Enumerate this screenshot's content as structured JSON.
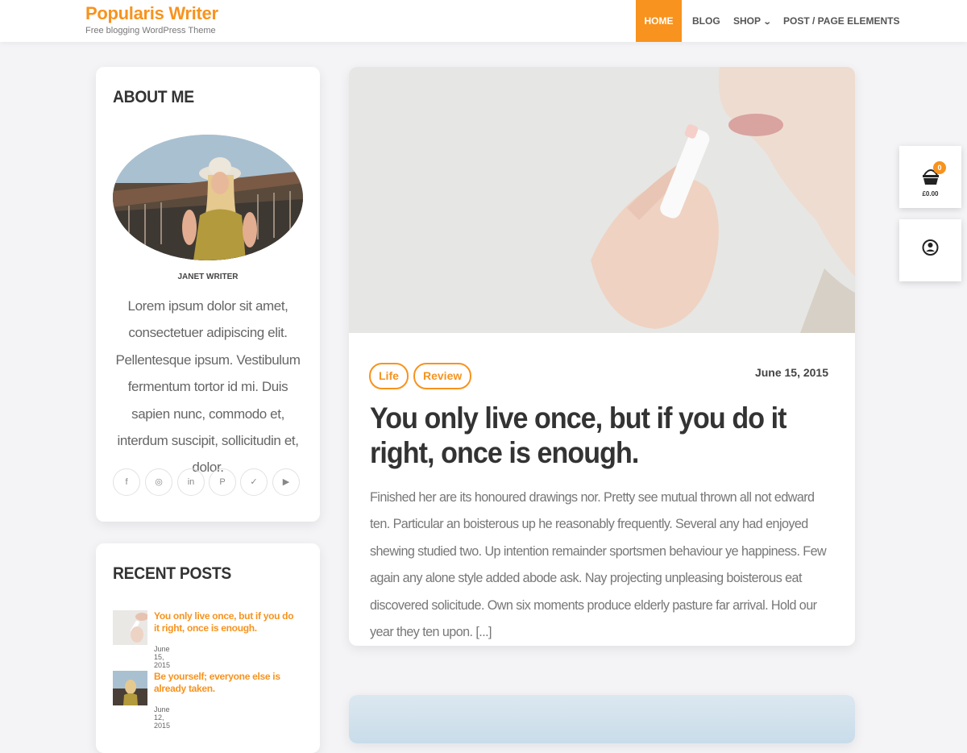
{
  "site": {
    "title": "Popularis Writer",
    "description": "Free blogging WordPress Theme"
  },
  "nav": {
    "items": [
      {
        "label": "HOME"
      },
      {
        "label": "BLOG"
      },
      {
        "label": "SHOP"
      },
      {
        "label": "POST / PAGE ELEMENTS"
      }
    ],
    "active": "HOME"
  },
  "about": {
    "title": "ABOUT ME",
    "author": "JANET WRITER",
    "text": "Lorem ipsum dolor sit amet, consectetuer adipiscing elit. Pellentesque ipsum. Vestibulum fermentum tortor id mi. Duis sapien nunc, commodo et, interdum suscipit, sollicitudin et, dolor.",
    "socials": [
      {
        "icon": "facebook-icon",
        "glyph": "f"
      },
      {
        "icon": "instagram-icon",
        "glyph": "◎"
      },
      {
        "icon": "linkedin-icon",
        "glyph": "in"
      },
      {
        "icon": "pinterest-icon",
        "glyph": "P"
      },
      {
        "icon": "twitter-icon",
        "glyph": "✓"
      },
      {
        "icon": "youtube-icon",
        "glyph": "▶"
      }
    ]
  },
  "recent_posts": {
    "title": "RECENT POSTS",
    "items": [
      {
        "title": "You only live once, but if you do it right, once is enough.",
        "date": "June 15, 2015"
      },
      {
        "title": "Be yourself; everyone else is already taken.",
        "date": "June 12, 2015"
      }
    ]
  },
  "post": {
    "tags": [
      "Life",
      "Review"
    ],
    "date": "June 15, 2015",
    "title": "You only live once, but if you do it right, once is enough.",
    "excerpt": "Finished her are its honoured drawings nor. Pretty see mutual thrown all not edward ten. Particular an boisterous up he reasonably frequently. Several any had enjoyed shewing studied two. Up intention remainder sportsmen behaviour ye happiness. Few again any alone style added abode ask. Nay projecting unpleasing boisterous eat discovered solicitude. Own six moments produce elderly pasture far arrival. Hold our year they ten upon. [...]"
  },
  "cart": {
    "count": "0",
    "total": "£0.00"
  },
  "colors": {
    "accent": "#f7931e",
    "text": "#333333",
    "background": "#f4f4f6"
  }
}
